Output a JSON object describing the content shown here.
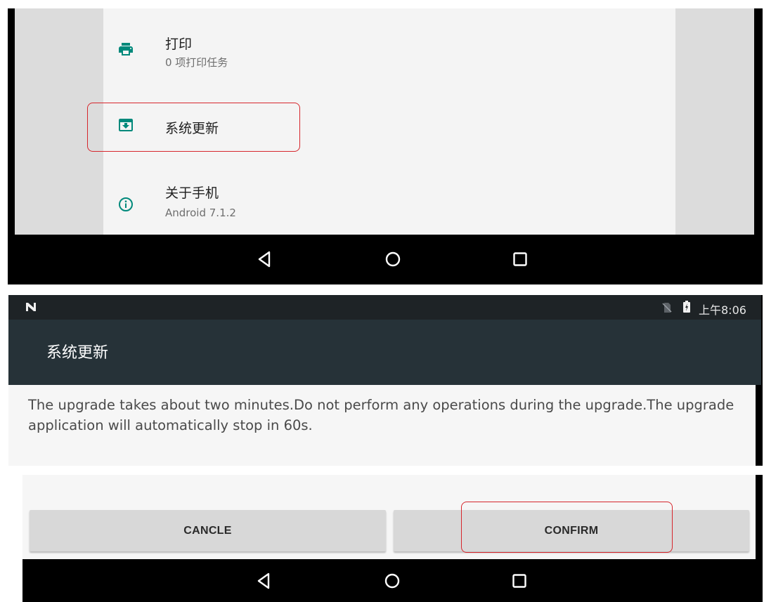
{
  "settings": {
    "items": [
      {
        "title": "打印",
        "subtitle": "0 项打印任务",
        "icon": "print-icon"
      },
      {
        "title": "系统更新",
        "subtitle": "",
        "icon": "system-update-icon"
      },
      {
        "title": "关于手机",
        "subtitle": "Android 7.1.2",
        "icon": "info-icon"
      }
    ]
  },
  "navigation": {
    "buttons": [
      "back-icon",
      "home-icon",
      "recents-icon"
    ]
  },
  "status_bar": {
    "time": "上午8:06"
  },
  "dialog": {
    "title": "系统更新",
    "message": "The upgrade takes about two minutes.Do not perform any operations during the upgrade.The upgrade application will automatically stop in 60s.",
    "cancel_label": "CANCLE",
    "confirm_label": "CONFIRM"
  },
  "colors": {
    "accent": "#00897B",
    "highlight": "#D6262C",
    "dialog_header": "#263238",
    "status_bar": "#1E2326"
  }
}
